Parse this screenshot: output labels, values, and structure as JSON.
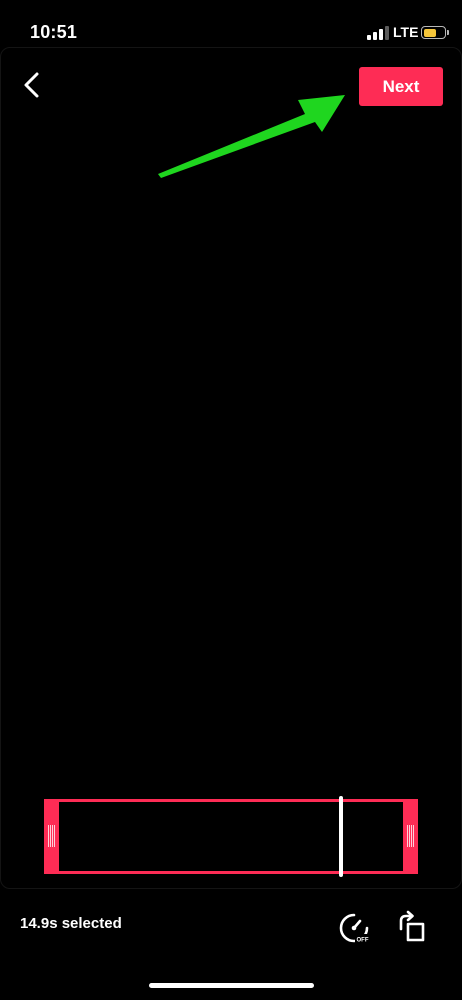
{
  "status_bar": {
    "time": "10:51",
    "network": "LTE",
    "signal_bars_active": 3,
    "signal_bars_total": 4,
    "battery_level": 0.62,
    "battery_color": "#f5c63a"
  },
  "header": {
    "back_icon": "chevron-left-icon",
    "next_label": "Next"
  },
  "annotation": {
    "arrow_icon": "arrow-pointer-icon",
    "arrow_color": "#1fd61f"
  },
  "trim": {
    "accent_color": "#fe2c55",
    "playhead_position": 0.79
  },
  "footer": {
    "selected_text": "14.9s selected",
    "speed_icon": "speed-off-icon",
    "speed_badge": "OFF",
    "rotate_icon": "rotate-icon"
  },
  "colors": {
    "background": "#000000",
    "accent": "#fe2c55"
  }
}
